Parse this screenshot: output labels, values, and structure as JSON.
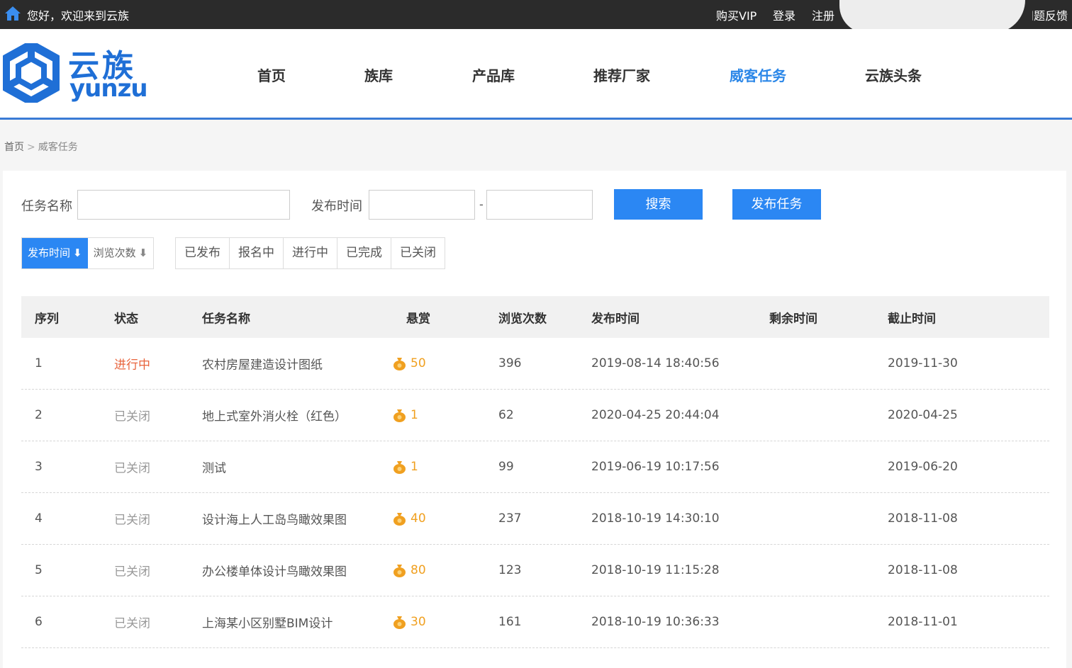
{
  "topbar": {
    "welcome": "您好，欢迎来到云族",
    "links": [
      "购买VIP",
      "登录",
      "注册"
    ],
    "feedback": "问题反馈"
  },
  "logo": {
    "cn": "云族",
    "en": "yunzu"
  },
  "nav": [
    {
      "label": "首页",
      "active": false
    },
    {
      "label": "族库",
      "active": false
    },
    {
      "label": "产品库",
      "active": false
    },
    {
      "label": "推荐厂家",
      "active": false
    },
    {
      "label": "威客任务",
      "active": true
    },
    {
      "label": "云族头条",
      "active": false
    }
  ],
  "breadcrumb": {
    "home": "首页",
    "sep": ">",
    "current": "威客任务"
  },
  "search": {
    "name_label": "任务名称",
    "name_value": "",
    "time_label": "发布时间",
    "time_from": "",
    "time_to": "",
    "dash": "-",
    "search_button": "搜索",
    "publish_button": "发布任务"
  },
  "sorts": [
    {
      "label": "发布时间",
      "arrow": "⬇",
      "active": true
    },
    {
      "label": "浏览次数",
      "arrow": "⬇",
      "active": false
    }
  ],
  "status_filters": [
    "已发布",
    "报名中",
    "进行中",
    "已完成",
    "已关闭"
  ],
  "table": {
    "headers": [
      "序列",
      "状态",
      "任务名称",
      "悬赏",
      "浏览次数",
      "发布时间",
      "剩余时间",
      "截止时间"
    ],
    "rows": [
      {
        "no": "1",
        "status": "进行中",
        "status_type": "active",
        "name": "农村房屋建造设计图纸",
        "reward": "50",
        "views": "396",
        "published": "2019-08-14 18:40:56",
        "remaining": "",
        "deadline": "2019-11-30"
      },
      {
        "no": "2",
        "status": "已关闭",
        "status_type": "closed",
        "name": "地上式室外消火栓（红色）",
        "reward": "1",
        "views": "62",
        "published": "2020-04-25 20:44:04",
        "remaining": "",
        "deadline": "2020-04-25"
      },
      {
        "no": "3",
        "status": "已关闭",
        "status_type": "closed",
        "name": "测试",
        "reward": "1",
        "views": "99",
        "published": "2019-06-19 10:17:56",
        "remaining": "",
        "deadline": "2019-06-20"
      },
      {
        "no": "4",
        "status": "已关闭",
        "status_type": "closed",
        "name": "设计海上人工岛鸟瞰效果图",
        "reward": "40",
        "views": "237",
        "published": "2018-10-19 14:30:10",
        "remaining": "",
        "deadline": "2018-11-08"
      },
      {
        "no": "5",
        "status": "已关闭",
        "status_type": "closed",
        "name": "办公楼单体设计鸟瞰效果图",
        "reward": "80",
        "views": "123",
        "published": "2018-10-19 11:15:28",
        "remaining": "",
        "deadline": "2018-11-08"
      },
      {
        "no": "6",
        "status": "已关闭",
        "status_type": "closed",
        "name": "上海某小区别墅BIM设计",
        "reward": "30",
        "views": "161",
        "published": "2018-10-19 10:36:33",
        "remaining": "",
        "deadline": "2018-11-01"
      }
    ]
  },
  "colors": {
    "brand": "#1f6fd6",
    "accent": "#2b87f3",
    "active_status": "#e8643c",
    "reward": "#f0a020"
  }
}
